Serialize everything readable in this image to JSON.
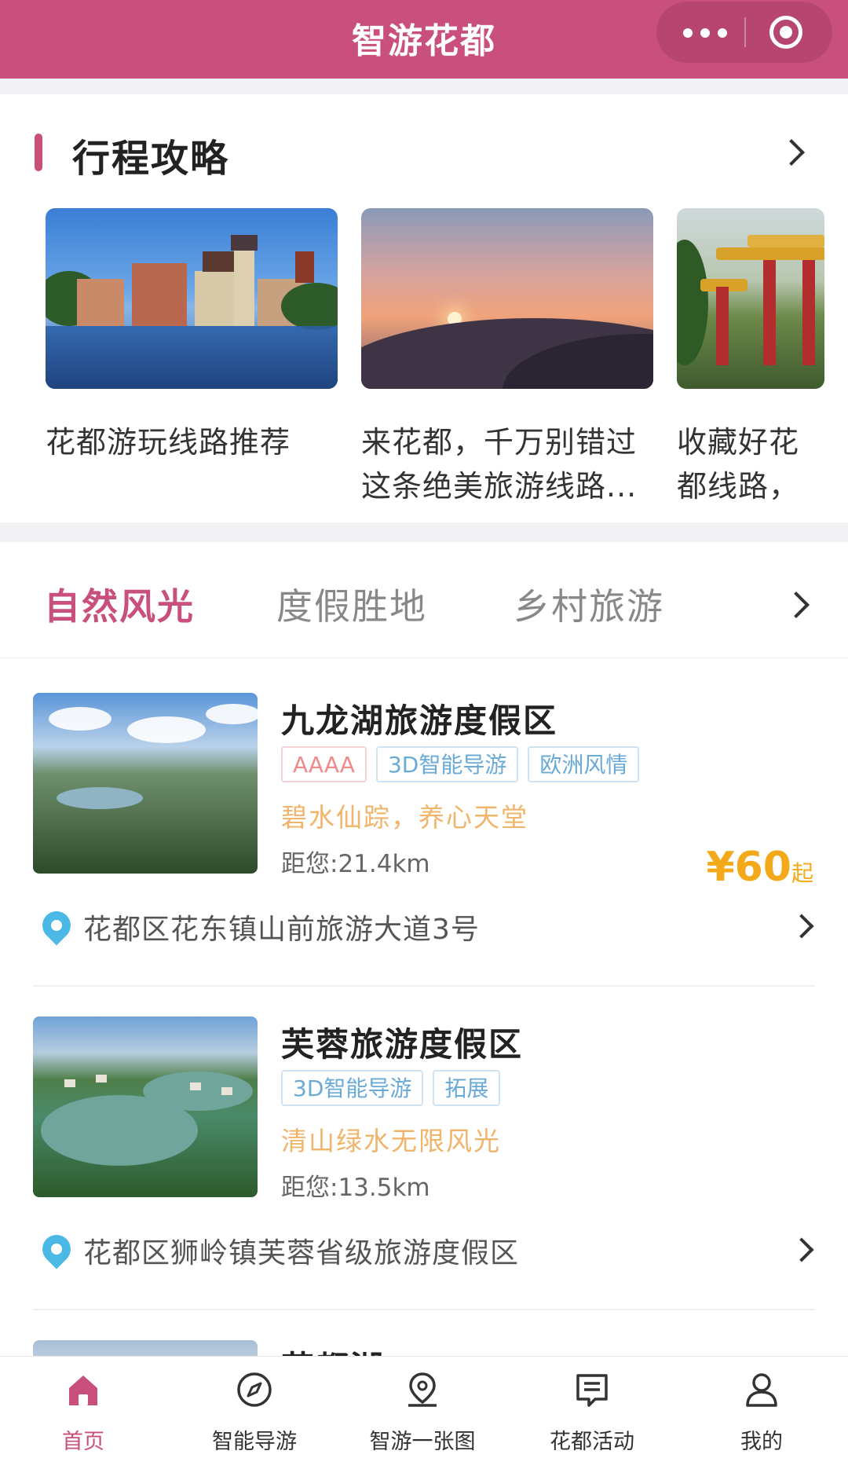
{
  "app": {
    "title": "智游花都"
  },
  "colors": {
    "brand": "#c94f7c",
    "tag_blue": "#6aaad6",
    "slogan": "#f0b46a",
    "price": "#f4a91a",
    "pin": "#4bb8e6"
  },
  "itinerary": {
    "heading": "行程攻略",
    "cards": [
      {
        "title": "花都游玩线路推荐",
        "image": "castle-lake-image"
      },
      {
        "title": "来花都，千万别错过这条绝美旅游线路...",
        "image": "mountain-sunset-image"
      },
      {
        "title": "收藏好花都线路，去天",
        "image": "park-gate-image"
      }
    ]
  },
  "category": {
    "tabs": [
      "自然风光",
      "度假胜地",
      "乡村旅游"
    ],
    "active_tab": 0,
    "items": [
      {
        "name": "九龙湖旅游度假区",
        "tags": [
          "AAAA",
          "3D智能导游",
          "欧洲风情"
        ],
        "slogan": "碧水仙踪，养心天堂",
        "distance": "距您:21.4km",
        "price": "¥60",
        "price_suffix": "起",
        "address": "花都区花东镇山前旅游大道3号"
      },
      {
        "name": "芙蓉旅游度假区",
        "tags": [
          "3D智能导游",
          "拓展"
        ],
        "slogan": "清山绿水无限风光",
        "distance": "距您:13.5km",
        "address": "花都区狮岭镇芙蓉省级旅游度假区"
      },
      {
        "name": "花都湖"
      }
    ]
  },
  "bottom_nav": {
    "items": [
      {
        "label": "首页",
        "icon": "home-icon",
        "active": true
      },
      {
        "label": "智能导游",
        "icon": "compass-icon",
        "active": false
      },
      {
        "label": "智游一张图",
        "icon": "map-pin-icon",
        "active": false
      },
      {
        "label": "花都活动",
        "icon": "notice-icon",
        "active": false
      },
      {
        "label": "我的",
        "icon": "user-icon",
        "active": false
      }
    ]
  }
}
